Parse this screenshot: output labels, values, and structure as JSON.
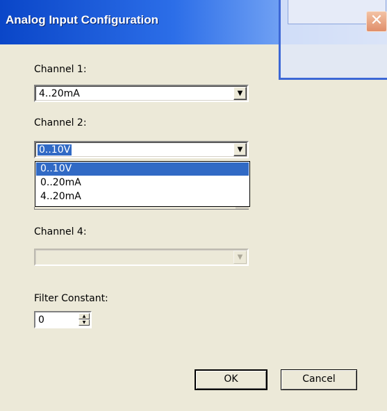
{
  "window": {
    "title": "Analog Input Configuration",
    "close_glyph": "✕"
  },
  "channel1": {
    "label": "Channel 1:",
    "value": "4..20mA"
  },
  "channel2": {
    "label": "Channel 2:",
    "value": "0..10V",
    "options": [
      "0..10V",
      "0..20mA",
      "4..20mA"
    ]
  },
  "channel4": {
    "label": "Channel 4:",
    "value": ""
  },
  "filter": {
    "label": "Filter Constant:",
    "value": "0"
  },
  "buttons": {
    "ok": "OK",
    "cancel": "Cancel"
  },
  "icons": {
    "dropdown": "▼",
    "spin_up": "▲",
    "spin_down": "▼"
  },
  "colors": {
    "title_bar": "#0a46c8",
    "selection": "#316ac5",
    "dialog_bg": "#ece9d8"
  }
}
